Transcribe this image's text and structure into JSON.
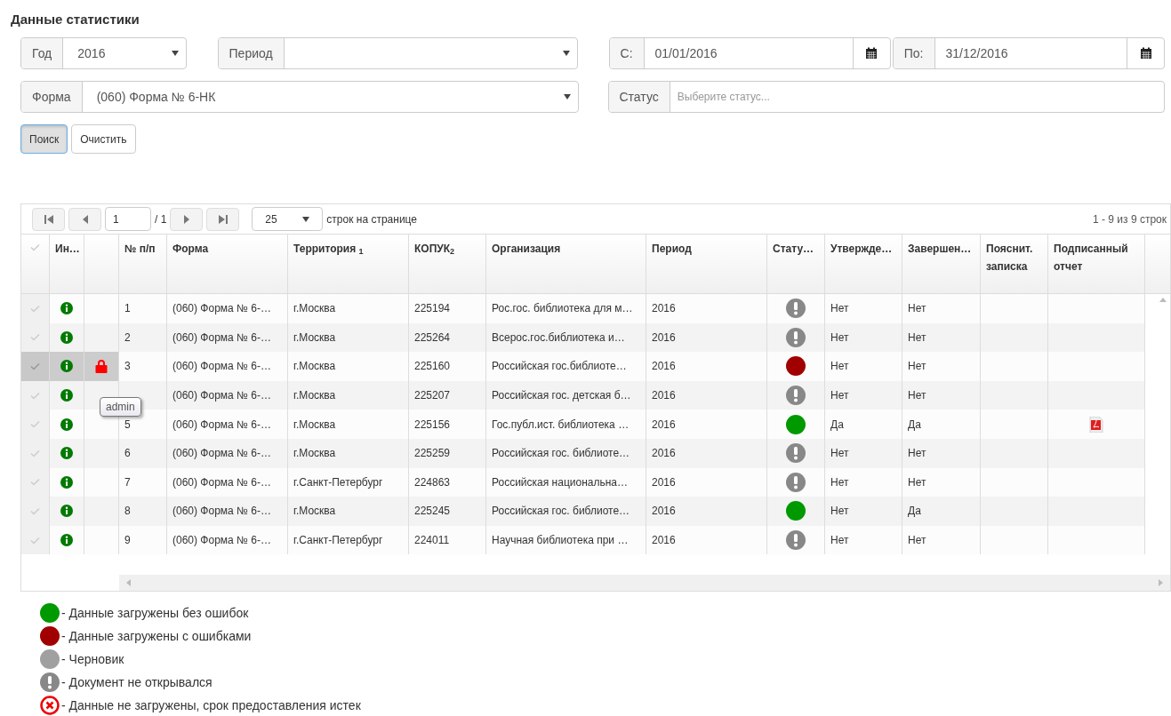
{
  "title": "Данные статистики",
  "filters": {
    "year": {
      "label": "Год",
      "value": "2016"
    },
    "period": {
      "label": "Период"
    },
    "from": {
      "label": "С:",
      "value": "01/01/2016"
    },
    "to": {
      "label": "По:",
      "value": "31/12/2016"
    },
    "form": {
      "label": "Форма",
      "value": "(060) Форма № 6-НК"
    },
    "status": {
      "label": "Статус",
      "placeholder": "Выберите статус..."
    }
  },
  "buttons": [
    {
      "label": "Поиск",
      "pressed": true
    },
    {
      "label": "Очистить",
      "pressed": false
    }
  ],
  "pager": {
    "page": "1",
    "of": "/ 1",
    "page_size": "25",
    "page_size_label": "строк на странице",
    "summary": "1 - 9 из 9 строк"
  },
  "table": {
    "columns": [
      "Ин…",
      "№ п/п",
      "Форма",
      "Территория $_{1}$",
      "КОПУК$_{2}$",
      "Организация",
      "Период",
      "Стату…",
      "Утвержде…",
      "Завершен…",
      "Пояснит. записка",
      "Подписанный отчет"
    ],
    "rows": [
      {
        "selected": false,
        "locked": false,
        "num": "1",
        "form": "(060) Форма № 6-…",
        "territory": "г.Москва",
        "kopuk": "225194",
        "org": "Рос.гос. библиотека для м…",
        "period": "2016",
        "status": {
          "kind": "not_opened"
        },
        "approved": "Нет",
        "completed": "Нет",
        "signed_report": false
      },
      {
        "selected": false,
        "locked": false,
        "num": "2",
        "form": "(060) Форма № 6-…",
        "territory": "г.Москва",
        "kopuk": "225264",
        "org": "Всерос.гос.библиотека и…",
        "period": "2016",
        "status": {
          "kind": "not_opened"
        },
        "approved": "Нет",
        "completed": "Нет",
        "signed_report": false
      },
      {
        "selected": true,
        "locked": true,
        "num": "3",
        "form": "(060) Форма № 6-…",
        "territory": "г.Москва",
        "kopuk": "225160",
        "org": "Российская гос.библиоте…",
        "period": "2016",
        "status": {
          "kind": "error"
        },
        "approved": "Нет",
        "completed": "Нет",
        "signed_report": false
      },
      {
        "selected": false,
        "locked": false,
        "form": "(060) Форма № 6-…",
        "territory": "г.Москва",
        "kopuk": "225207",
        "org": "Российская гос. детская б…",
        "period": "2016",
        "status": {
          "kind": "not_opened"
        },
        "approved": "Нет",
        "completed": "Нет",
        "signed_report": false
      },
      {
        "selected": false,
        "locked": false,
        "num": "5",
        "form": "(060) Форма № 6-…",
        "territory": "г.Москва",
        "kopuk": "225156",
        "org": "Гос.публ.ист. библиотека …",
        "period": "2016",
        "status": {
          "kind": "ok"
        },
        "approved": "Да",
        "completed": "Да",
        "signed_report": true
      },
      {
        "selected": false,
        "locked": false,
        "num": "6",
        "form": "(060) Форма № 6-…",
        "territory": "г.Москва",
        "kopuk": "225259",
        "org": "Российская гос. библиоте…",
        "period": "2016",
        "status": {
          "kind": "not_opened"
        },
        "approved": "Нет",
        "completed": "Нет",
        "signed_report": false
      },
      {
        "selected": false,
        "locked": false,
        "num": "7",
        "form": "(060) Форма № 6-…",
        "territory": "г.Санкт-Петербург",
        "kopuk": "224863",
        "org": "Российская национальна…",
        "period": "2016",
        "status": {
          "kind": "not_opened"
        },
        "approved": "Нет",
        "completed": "Нет",
        "signed_report": false
      },
      {
        "selected": false,
        "locked": false,
        "num": "8",
        "form": "(060) Форма № 6-…",
        "territory": "г.Москва",
        "kopuk": "225245",
        "org": "Российская гос. библиоте…",
        "period": "2016",
        "status": {
          "kind": "ok"
        },
        "approved": "Нет",
        "completed": "Да",
        "signed_report": false
      },
      {
        "selected": false,
        "locked": false,
        "num": "9",
        "form": "(060) Форма № 6-…",
        "territory": "г.Санкт-Петербург",
        "kopuk": "224011",
        "org": "Научная библиотека при …",
        "period": "2016",
        "status": {
          "kind": "not_opened"
        },
        "approved": "Нет",
        "completed": "Нет",
        "signed_report": false
      }
    ]
  },
  "tooltip": "admin",
  "legend": [
    {
      "kind": "ok",
      "text": "- Данные загружены без ошибок"
    },
    {
      "kind": "error",
      "text": "- Данные загружены с ошибками"
    },
    {
      "kind": "draft",
      "text": "- Черновик"
    },
    {
      "kind": "not_opened",
      "text": "- Документ не открывался"
    },
    {
      "kind": "not_loaded",
      "text": "- Данные не загружены, срок предоставления истек"
    }
  ]
}
